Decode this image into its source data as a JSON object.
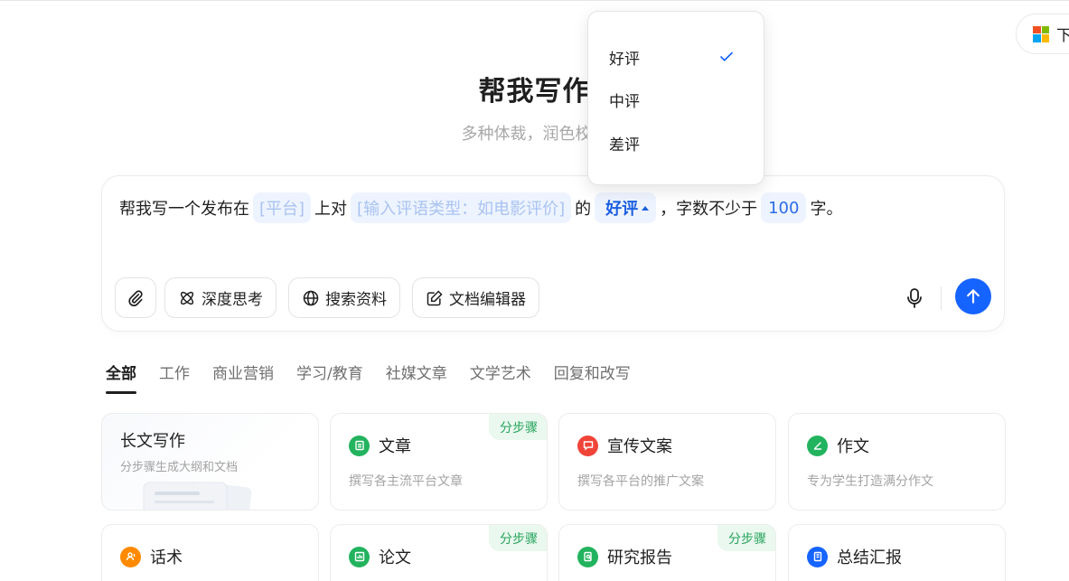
{
  "header": {
    "download_label": "下",
    "title": "帮我写作",
    "subtitle": "多种体裁，润色校对"
  },
  "composer": {
    "prompt_prefix": "帮我写一个发布在",
    "slot_platform": "[平台]",
    "text_on": "上对",
    "slot_review_type": "[输入评语类型：如电影评价]",
    "text_de": "的",
    "slot_rating": "好评",
    "text_word_count": "，字数不少于",
    "slot_count": "100",
    "text_end": "字。",
    "tools": {
      "deep_think": "深度思考",
      "search": "搜索资料",
      "doc_editor": "文档编辑器"
    }
  },
  "dropdown": {
    "options": [
      "好评",
      "中评",
      "差评"
    ],
    "selected": "好评"
  },
  "tabs": [
    "全部",
    "工作",
    "商业营销",
    "学习/教育",
    "社媒文章",
    "文学艺术",
    "回复和改写"
  ],
  "cards": {
    "long_writing": {
      "title": "长文写作",
      "desc": "分步骤生成大纲和文档"
    },
    "article": {
      "title": "文章",
      "desc": "撰写各主流平台文章",
      "badge": "分步骤"
    },
    "promo": {
      "title": "宣传文案",
      "desc": "撰写各平台的推广文案"
    },
    "essay": {
      "title": "作文",
      "desc": "专为学生打造满分作文"
    },
    "script": {
      "title": "话术"
    },
    "paper": {
      "title": "论文",
      "badge": "分步骤"
    },
    "research": {
      "title": "研究报告",
      "badge": "分步骤"
    },
    "summary": {
      "title": "总结汇报"
    }
  },
  "colors": {
    "accent": "#1664ff",
    "green": "#22b35e",
    "red": "#f04438",
    "orange": "#ff8a00",
    "blue": "#1664ff"
  }
}
